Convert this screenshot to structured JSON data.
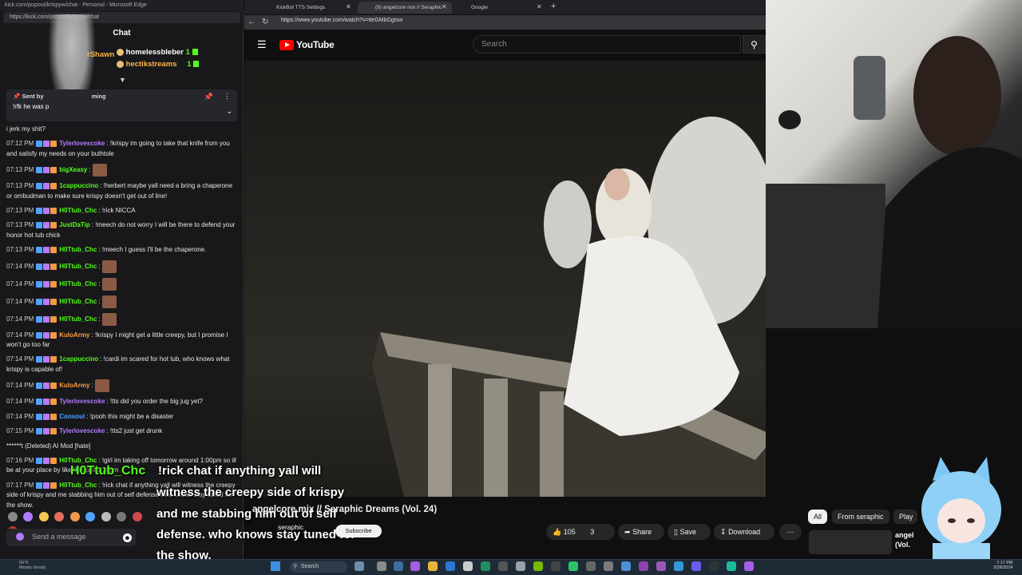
{
  "chat_window": {
    "title": "kick.com/popout/krispyw/chat - Personal - Microsoft Edge",
    "url": "https://kick.com/popout/krispyw/chat",
    "header": "Chat",
    "leaderboard": [
      {
        "name": "homelessbleber",
        "count": "1"
      },
      {
        "name": "hectikstreams",
        "count": "1"
      }
    ],
    "leaderboard_left_fragment": "rShawn",
    "pinned": {
      "label": "Sent by",
      "suffix": "ming",
      "text": "!rfk he was p"
    },
    "messages": [
      {
        "time": "",
        "user": "",
        "color": "#e8e8e8",
        "text": "i jerk my shit?"
      },
      {
        "time": "07:12 PM",
        "user": "Tylerlovescoke",
        "color": "#b37bff",
        "text": "!krispy im going to take that knife from you and satisfy my needs on your buthtole"
      },
      {
        "time": "07:13 PM",
        "user": "bigXeasy",
        "color": "#53fc18",
        "text": ""
      },
      {
        "time": "07:13 PM",
        "user": "1cappuccino",
        "color": "#53fc18",
        "text": "!herbert maybe yall need a bring a chaperone or ombudman to make sure krispy doesn't get out of line!"
      },
      {
        "time": "07:13 PM",
        "user": "H0Ttub_Chc",
        "color": "#53fc18",
        "text": "!rick NICCA"
      },
      {
        "time": "07:13 PM",
        "user": "JustDaTip",
        "color": "#53fc18",
        "text": "!meech do not worry I will be there to defend your honor hot tub chick"
      },
      {
        "time": "07:13 PM",
        "user": "H0Ttub_Chc",
        "color": "#53fc18",
        "text": "!meech I guess I'll be the chaperone."
      },
      {
        "time": "07:14 PM",
        "user": "H0Ttub_Chc",
        "color": "#53fc18",
        "text": ""
      },
      {
        "time": "07:14 PM",
        "user": "H0Ttub_Chc",
        "color": "#53fc18",
        "text": ""
      },
      {
        "time": "07:14 PM",
        "user": "H0Ttub_Chc",
        "color": "#53fc18",
        "text": ""
      },
      {
        "time": "07:14 PM",
        "user": "H0Ttub_Chc",
        "color": "#53fc18",
        "text": ""
      },
      {
        "time": "07:14 PM",
        "user": "KuloArmy",
        "color": "#ff9d3c",
        "text": "!krispy I might get a little creepy, but I promise I won't go too far"
      },
      {
        "time": "07:14 PM",
        "user": "1cappuccino",
        "color": "#53fc18",
        "text": "!cardi im scared for hot tub, who knows what krispy is capable of!"
      },
      {
        "time": "07:14 PM",
        "user": "KuloArmy",
        "color": "#ff9d3c",
        "text": ""
      },
      {
        "time": "07:14 PM",
        "user": "Tylerlovescoke",
        "color": "#b37bff",
        "text": "!tts did you order the big jug yet?"
      },
      {
        "time": "07:14 PM",
        "user": "Consoul",
        "color": "#4fa3ff",
        "text": "!pooh this might be a disaster"
      },
      {
        "time": "07:15 PM",
        "user": "Tylerlovescoke",
        "color": "#b37bff",
        "text": "!tts2 just get drunk"
      },
      {
        "time": "",
        "user": "",
        "color": "#e8e8e8",
        "text": "******t (Deleted) AI Mod [hate]"
      },
      {
        "time": "07:16 PM",
        "user": "H0Ttub_Chc",
        "color": "#53fc18",
        "text": "!girl im taking off tomorrow around 1:00pm so ill be at your place by like 2:00pm-2:30pm"
      },
      {
        "time": "07:17 PM",
        "user": "H0Ttub_Chc",
        "color": "#53fc18",
        "text": "!rick chat if anything yall will witness the creepy side of krispy and me stabbing him out of self defense who knows stay tuned for the show."
      }
    ],
    "send_placeholder": "Send a message"
  },
  "browser": {
    "tabs": [
      {
        "label": "KickBot TTS Settings",
        "active": false
      },
      {
        "label": "(9) angelcore mix // Seraphic",
        "active": true
      },
      {
        "label": "Google",
        "active": false
      }
    ],
    "url": "https://www.youtube.com/watch?v=tteGMbGgtsw",
    "logo": "YouTube",
    "search_placeholder": "Search"
  },
  "caption": {
    "user": "H0Ttub_Chc",
    "lines": [
      "!rick chat if anything yall will",
      "witness the creepy side of krispy",
      "and me stabbing him out of self",
      "defense. who knows stay tuned for",
      "the show."
    ]
  },
  "video_info": {
    "title": "angelcore mix // Seraphic Dreams (Vol. 24)",
    "channel": "seraphic",
    "subscribe": "Subscribe",
    "likes": "105",
    "dislikes": "3",
    "share": "Share",
    "save": "Save",
    "download": "Download",
    "more": "⋯"
  },
  "chips": [
    {
      "label": "All",
      "selected": true
    },
    {
      "label": "From seraphic",
      "selected": false
    },
    {
      "label": "Play",
      "selected": false
    }
  ],
  "recommended": {
    "title": "angel",
    "subtitle": "(Vol."
  },
  "taskbar": {
    "weather_temp": "56°F",
    "weather_desc": "Mostly cloudy",
    "search": "Search",
    "time": "7:17 PM",
    "date": "3/28/2024"
  },
  "colors": {
    "accent": "#53fc18",
    "yt_red": "#ff0000",
    "chat_bg": "#18181b"
  }
}
